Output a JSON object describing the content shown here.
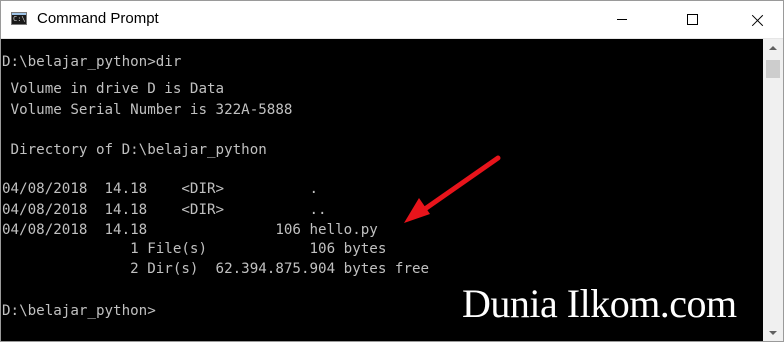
{
  "window": {
    "title": "Command Prompt",
    "icon": "cmd-icon",
    "buttons": {
      "minimize": "minimize-icon",
      "maximize": "maximize-icon",
      "close": "close-icon"
    }
  },
  "console": {
    "lines": [
      "D:\\belajar_python>dir",
      " Volume in drive D is Data",
      " Volume Serial Number is 322A-5888",
      "",
      " Directory of D:\\belajar_python",
      "",
      "04/08/2018  14.18    <DIR>          .",
      "04/08/2018  14.18    <DIR>          ..",
      "04/08/2018  14.18               106 hello.py",
      "               1 File(s)            106 bytes",
      "               2 Dir(s)  62.394.875.904 bytes free",
      "",
      "D:\\belajar_python>"
    ],
    "text_color": "#c0c0c0",
    "background": "#000000"
  },
  "annotation": {
    "arrow_color": "#e8141b"
  },
  "watermark": "Dunia Ilkom.com"
}
